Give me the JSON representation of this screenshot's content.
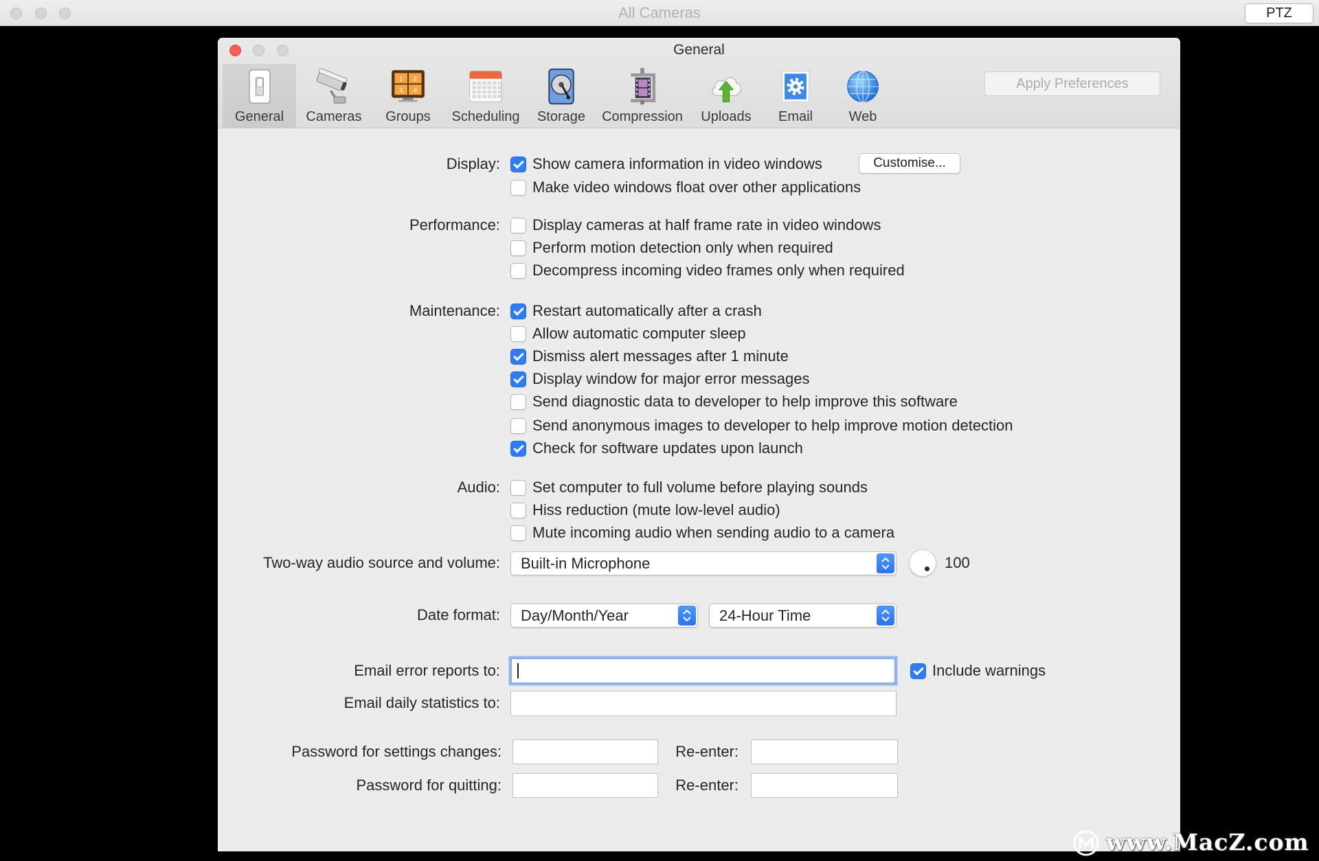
{
  "window": {
    "title": "All Cameras",
    "ptz_label": "PTZ"
  },
  "prefs": {
    "title": "General",
    "apply_label": "Apply Preferences",
    "toolbar": [
      {
        "label": "General",
        "icon": "light-switch-icon",
        "selected": true
      },
      {
        "label": "Cameras",
        "icon": "security-camera-icon",
        "selected": false
      },
      {
        "label": "Groups",
        "icon": "camera-grid-icon",
        "selected": false
      },
      {
        "label": "Scheduling",
        "icon": "calendar-icon",
        "selected": false
      },
      {
        "label": "Storage",
        "icon": "hard-drive-icon",
        "selected": false
      },
      {
        "label": "Compression",
        "icon": "film-clamp-icon",
        "selected": false
      },
      {
        "label": "Uploads",
        "icon": "cloud-upload-icon",
        "selected": false
      },
      {
        "label": "Email",
        "icon": "stamp-icon",
        "selected": false
      },
      {
        "label": "Web",
        "icon": "globe-icon",
        "selected": false
      }
    ],
    "groups_icon_digits": [
      "1",
      "2",
      "3",
      "4"
    ]
  },
  "display": {
    "label": "Display:",
    "customise_label": "Customise...",
    "options": [
      {
        "label": "Show camera information in video windows",
        "checked": true
      },
      {
        "label": "Make video windows float over other applications",
        "checked": false
      }
    ]
  },
  "performance": {
    "label": "Performance:",
    "options": [
      {
        "label": "Display cameras at half frame rate in video windows",
        "checked": false
      },
      {
        "label": "Perform motion detection only when required",
        "checked": false
      },
      {
        "label": "Decompress incoming video frames only when required",
        "checked": false
      }
    ]
  },
  "maintenance": {
    "label": "Maintenance:",
    "options": [
      {
        "label": "Restart automatically after a crash",
        "checked": true
      },
      {
        "label": "Allow automatic computer sleep",
        "checked": false
      },
      {
        "label": "Dismiss alert messages after 1 minute",
        "checked": true
      },
      {
        "label": "Display window for major error messages",
        "checked": true
      },
      {
        "label": "Send diagnostic data to developer to help improve this software",
        "checked": false
      },
      {
        "label": "Send anonymous images to developer to help improve motion detection",
        "checked": false
      },
      {
        "label": "Check for software updates upon launch",
        "checked": true
      }
    ]
  },
  "audio": {
    "label": "Audio:",
    "options": [
      {
        "label": "Set computer to full volume before playing sounds",
        "checked": false
      },
      {
        "label": "Hiss reduction (mute low-level audio)",
        "checked": false
      },
      {
        "label": "Mute incoming audio when sending audio to a camera",
        "checked": false
      }
    ]
  },
  "two_way_audio": {
    "label": "Two-way audio source and volume:",
    "source": "Built-in Microphone",
    "volume": "100"
  },
  "date_format": {
    "label": "Date format:",
    "date": "Day/Month/Year",
    "time": "24-Hour Time"
  },
  "email": {
    "error_label": "Email error reports to:",
    "error_value": "",
    "include_warnings_label": "Include warnings",
    "include_warnings": true,
    "daily_label": "Email daily statistics to:",
    "daily_value": ""
  },
  "passwords": {
    "settings_label": "Password for settings changes:",
    "quitting_label": "Password for quitting:",
    "reenter_label": "Re-enter:",
    "settings_value": "",
    "settings_reenter_value": "",
    "quitting_value": "",
    "quitting_reenter_value": ""
  },
  "watermark": "www.MacZ.com",
  "colors": {
    "accent": "#2f7df6",
    "close_button": "#fd5d55"
  }
}
